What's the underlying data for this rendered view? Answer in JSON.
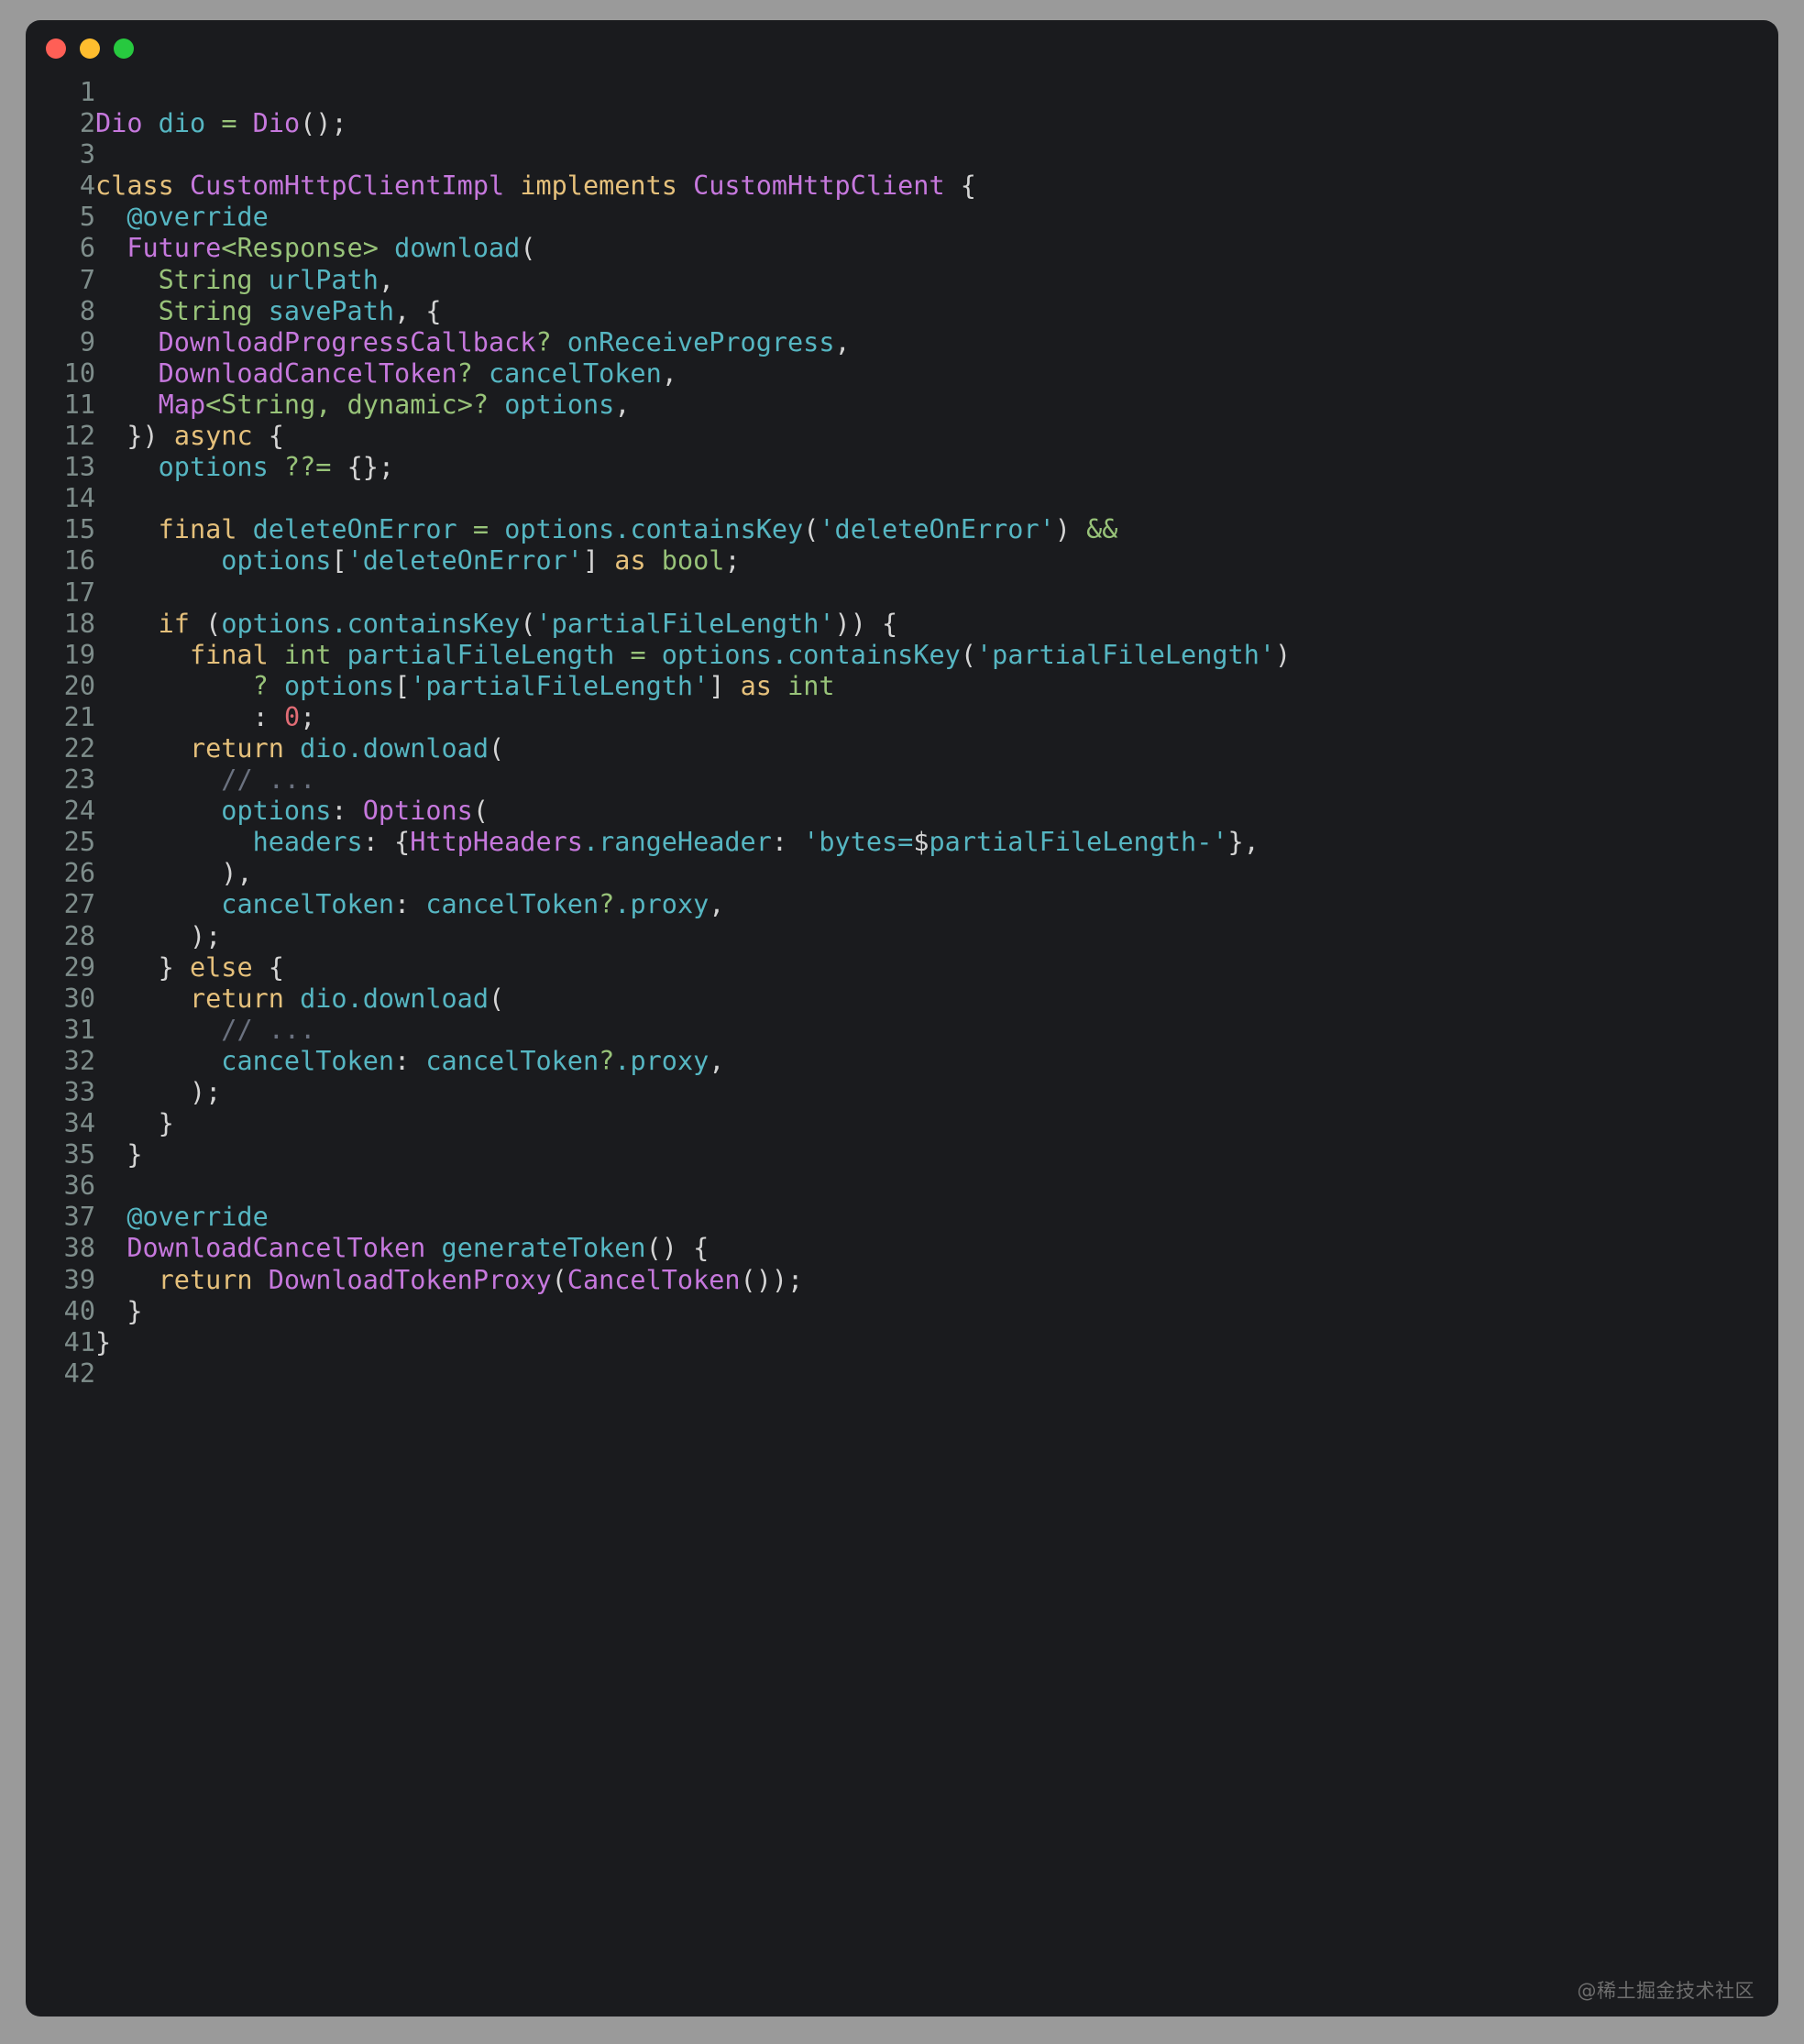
{
  "window": {
    "traffic_lights": [
      {
        "name": "close",
        "color": "#ff5f56"
      },
      {
        "name": "minimize",
        "color": "#ffbd2e"
      },
      {
        "name": "maximize",
        "color": "#27c93f"
      }
    ],
    "background": "#1a1b1e",
    "page_background": "#9a9a9a"
  },
  "watermark": "@稀土掘金技术社区",
  "editor": {
    "language": "dart",
    "first_line_number": 1,
    "last_line_number": 42,
    "line_numbers": [
      "1",
      "2",
      "3",
      "4",
      "5",
      "6",
      "7",
      "8",
      "9",
      "10",
      "11",
      "12",
      "13",
      "14",
      "15",
      "16",
      "17",
      "18",
      "19",
      "20",
      "21",
      "22",
      "23",
      "24",
      "25",
      "26",
      "27",
      "28",
      "29",
      "30",
      "31",
      "32",
      "33",
      "34",
      "35",
      "36",
      "37",
      "38",
      "39",
      "40",
      "41",
      "42"
    ],
    "lines_plain": [
      "",
      "Dio dio = Dio();",
      "",
      "class CustomHttpClientImpl implements CustomHttpClient {",
      "  @override",
      "  Future<Response> download(",
      "    String urlPath,",
      "    String savePath, {",
      "    DownloadProgressCallback? onReceiveProgress,",
      "    DownloadCancelToken? cancelToken,",
      "    Map<String, dynamic>? options,",
      "  }) async {",
      "    options ??= {};",
      "",
      "    final deleteOnError = options.containsKey('deleteOnError') &&",
      "        options['deleteOnError'] as bool;",
      "",
      "    if (options.containsKey('partialFileLength')) {",
      "      final int partialFileLength = options.containsKey('partialFileLength')",
      "          ? options['partialFileLength'] as int",
      "          : 0;",
      "      return dio.download(",
      "        // ...",
      "        options: Options(",
      "          headers: {HttpHeaders.rangeHeader: 'bytes=$partialFileLength-'},",
      "        ),",
      "        cancelToken: cancelToken?.proxy,",
      "      );",
      "    } else {",
      "      return dio.download(",
      "        // ...",
      "        cancelToken: cancelToken?.proxy,",
      "      );",
      "    }",
      "  }",
      "",
      "  @override",
      "  DownloadCancelToken generateToken() {",
      "    return DownloadTokenProxy(CancelToken());",
      "  }",
      "}",
      ""
    ],
    "lines": [
      [],
      [
        {
          "t": "Dio",
          "c": "ty"
        },
        {
          "t": " ",
          "c": "pu"
        },
        {
          "t": "dio",
          "c": "id"
        },
        {
          "t": " ",
          "c": "pu"
        },
        {
          "t": "=",
          "c": "op"
        },
        {
          "t": " ",
          "c": "pu"
        },
        {
          "t": "Dio",
          "c": "ty"
        },
        {
          "t": "();",
          "c": "pu"
        }
      ],
      [],
      [
        {
          "t": "class",
          "c": "k"
        },
        {
          "t": " ",
          "c": "pu"
        },
        {
          "t": "CustomHttpClientImpl",
          "c": "ty"
        },
        {
          "t": " ",
          "c": "pu"
        },
        {
          "t": "implements",
          "c": "k"
        },
        {
          "t": " ",
          "c": "pu"
        },
        {
          "t": "CustomHttpClient",
          "c": "ty"
        },
        {
          "t": " {",
          "c": "pu"
        }
      ],
      [
        {
          "t": "  ",
          "c": "pu"
        },
        {
          "t": "@override",
          "c": "id"
        }
      ],
      [
        {
          "t": "  ",
          "c": "pu"
        },
        {
          "t": "Future",
          "c": "ty"
        },
        {
          "t": "<",
          "c": "bi"
        },
        {
          "t": "Response",
          "c": "bi"
        },
        {
          "t": ">",
          "c": "bi"
        },
        {
          "t": " ",
          "c": "pu"
        },
        {
          "t": "download",
          "c": "id"
        },
        {
          "t": "(",
          "c": "pu"
        }
      ],
      [
        {
          "t": "    ",
          "c": "pu"
        },
        {
          "t": "String",
          "c": "bi"
        },
        {
          "t": " ",
          "c": "pu"
        },
        {
          "t": "urlPath",
          "c": "id"
        },
        {
          "t": ",",
          "c": "pu"
        }
      ],
      [
        {
          "t": "    ",
          "c": "pu"
        },
        {
          "t": "String",
          "c": "bi"
        },
        {
          "t": " ",
          "c": "pu"
        },
        {
          "t": "savePath",
          "c": "id"
        },
        {
          "t": ", {",
          "c": "pu"
        }
      ],
      [
        {
          "t": "    ",
          "c": "pu"
        },
        {
          "t": "DownloadProgressCallback",
          "c": "ty"
        },
        {
          "t": "?",
          "c": "op"
        },
        {
          "t": " ",
          "c": "pu"
        },
        {
          "t": "onReceiveProgress",
          "c": "id"
        },
        {
          "t": ",",
          "c": "pu"
        }
      ],
      [
        {
          "t": "    ",
          "c": "pu"
        },
        {
          "t": "DownloadCancelToken",
          "c": "ty"
        },
        {
          "t": "?",
          "c": "op"
        },
        {
          "t": " ",
          "c": "pu"
        },
        {
          "t": "cancelToken",
          "c": "id"
        },
        {
          "t": ",",
          "c": "pu"
        }
      ],
      [
        {
          "t": "    ",
          "c": "pu"
        },
        {
          "t": "Map",
          "c": "ty"
        },
        {
          "t": "<",
          "c": "bi"
        },
        {
          "t": "String",
          "c": "bi"
        },
        {
          "t": ",",
          "c": "bi"
        },
        {
          "t": " ",
          "c": "pu"
        },
        {
          "t": "dynamic",
          "c": "bi"
        },
        {
          "t": ">",
          "c": "bi"
        },
        {
          "t": "?",
          "c": "op"
        },
        {
          "t": " ",
          "c": "pu"
        },
        {
          "t": "options",
          "c": "id"
        },
        {
          "t": ",",
          "c": "pu"
        }
      ],
      [
        {
          "t": "  })",
          "c": "pu"
        },
        {
          "t": " ",
          "c": "pu"
        },
        {
          "t": "async",
          "c": "k"
        },
        {
          "t": " {",
          "c": "pu"
        }
      ],
      [
        {
          "t": "    ",
          "c": "pu"
        },
        {
          "t": "options",
          "c": "id"
        },
        {
          "t": " ",
          "c": "pu"
        },
        {
          "t": "??",
          "c": "op"
        },
        {
          "t": "=",
          "c": "op"
        },
        {
          "t": " ",
          "c": "pu"
        },
        {
          "t": "{};",
          "c": "pu"
        }
      ],
      [],
      [
        {
          "t": "    ",
          "c": "pu"
        },
        {
          "t": "final",
          "c": "k"
        },
        {
          "t": " ",
          "c": "pu"
        },
        {
          "t": "deleteOnError",
          "c": "id"
        },
        {
          "t": " ",
          "c": "pu"
        },
        {
          "t": "=",
          "c": "op"
        },
        {
          "t": " ",
          "c": "pu"
        },
        {
          "t": "options",
          "c": "id"
        },
        {
          "t": ".",
          "c": "id"
        },
        {
          "t": "containsKey",
          "c": "id"
        },
        {
          "t": "(",
          "c": "pu"
        },
        {
          "t": "'deleteOnError'",
          "c": "st"
        },
        {
          "t": ")",
          "c": "pu"
        },
        {
          "t": " ",
          "c": "pu"
        },
        {
          "t": "&&",
          "c": "op"
        }
      ],
      [
        {
          "t": "        ",
          "c": "pu"
        },
        {
          "t": "options",
          "c": "id"
        },
        {
          "t": "[",
          "c": "pu"
        },
        {
          "t": "'deleteOnError'",
          "c": "st"
        },
        {
          "t": "]",
          "c": "pu"
        },
        {
          "t": " ",
          "c": "pu"
        },
        {
          "t": "as",
          "c": "k"
        },
        {
          "t": " ",
          "c": "pu"
        },
        {
          "t": "bool",
          "c": "bi"
        },
        {
          "t": ";",
          "c": "pu"
        }
      ],
      [],
      [
        {
          "t": "    ",
          "c": "pu"
        },
        {
          "t": "if",
          "c": "k"
        },
        {
          "t": " ",
          "c": "pu"
        },
        {
          "t": "(",
          "c": "pu"
        },
        {
          "t": "options",
          "c": "id"
        },
        {
          "t": ".",
          "c": "id"
        },
        {
          "t": "containsKey",
          "c": "id"
        },
        {
          "t": "(",
          "c": "pu"
        },
        {
          "t": "'partialFileLength'",
          "c": "st"
        },
        {
          "t": "))",
          "c": "pu"
        },
        {
          "t": " {",
          "c": "pu"
        }
      ],
      [
        {
          "t": "      ",
          "c": "pu"
        },
        {
          "t": "final",
          "c": "k"
        },
        {
          "t": " ",
          "c": "pu"
        },
        {
          "t": "int",
          "c": "bi"
        },
        {
          "t": " ",
          "c": "pu"
        },
        {
          "t": "partialFileLength",
          "c": "id"
        },
        {
          "t": " ",
          "c": "pu"
        },
        {
          "t": "=",
          "c": "op"
        },
        {
          "t": " ",
          "c": "pu"
        },
        {
          "t": "options",
          "c": "id"
        },
        {
          "t": ".",
          "c": "id"
        },
        {
          "t": "containsKey",
          "c": "id"
        },
        {
          "t": "(",
          "c": "pu"
        },
        {
          "t": "'partialFileLength'",
          "c": "st"
        },
        {
          "t": ")",
          "c": "pu"
        }
      ],
      [
        {
          "t": "          ",
          "c": "pu"
        },
        {
          "t": "?",
          "c": "op"
        },
        {
          "t": " ",
          "c": "pu"
        },
        {
          "t": "options",
          "c": "id"
        },
        {
          "t": "[",
          "c": "pu"
        },
        {
          "t": "'partialFileLength'",
          "c": "st"
        },
        {
          "t": "]",
          "c": "pu"
        },
        {
          "t": " ",
          "c": "pu"
        },
        {
          "t": "as",
          "c": "k"
        },
        {
          "t": " ",
          "c": "pu"
        },
        {
          "t": "int",
          "c": "bi"
        }
      ],
      [
        {
          "t": "          ",
          "c": "pu"
        },
        {
          "t": ":",
          "c": "pu"
        },
        {
          "t": " ",
          "c": "pu"
        },
        {
          "t": "0",
          "c": "nu"
        },
        {
          "t": ";",
          "c": "pu"
        }
      ],
      [
        {
          "t": "      ",
          "c": "pu"
        },
        {
          "t": "return",
          "c": "k"
        },
        {
          "t": " ",
          "c": "pu"
        },
        {
          "t": "dio",
          "c": "id"
        },
        {
          "t": ".",
          "c": "id"
        },
        {
          "t": "download",
          "c": "id"
        },
        {
          "t": "(",
          "c": "pu"
        }
      ],
      [
        {
          "t": "        ",
          "c": "pu"
        },
        {
          "t": "// ...",
          "c": "cm"
        }
      ],
      [
        {
          "t": "        ",
          "c": "pu"
        },
        {
          "t": "options",
          "c": "id"
        },
        {
          "t": ":",
          "c": "pu"
        },
        {
          "t": " ",
          "c": "pu"
        },
        {
          "t": "Options",
          "c": "ty"
        },
        {
          "t": "(",
          "c": "pu"
        }
      ],
      [
        {
          "t": "          ",
          "c": "pu"
        },
        {
          "t": "headers",
          "c": "id"
        },
        {
          "t": ":",
          "c": "pu"
        },
        {
          "t": " {",
          "c": "pu"
        },
        {
          "t": "HttpHeaders",
          "c": "ty"
        },
        {
          "t": ".",
          "c": "id"
        },
        {
          "t": "rangeHeader",
          "c": "id"
        },
        {
          "t": ":",
          "c": "pu"
        },
        {
          "t": " ",
          "c": "pu"
        },
        {
          "t": "'bytes=",
          "c": "st"
        },
        {
          "t": "$",
          "c": "iv"
        },
        {
          "t": "partialFileLength-'",
          "c": "st"
        },
        {
          "t": "},",
          "c": "pu"
        }
      ],
      [
        {
          "t": "        ),",
          "c": "pu"
        }
      ],
      [
        {
          "t": "        ",
          "c": "pu"
        },
        {
          "t": "cancelToken",
          "c": "id"
        },
        {
          "t": ":",
          "c": "pu"
        },
        {
          "t": " ",
          "c": "pu"
        },
        {
          "t": "cancelToken",
          "c": "id"
        },
        {
          "t": "?",
          "c": "op"
        },
        {
          "t": ".",
          "c": "id"
        },
        {
          "t": "proxy",
          "c": "id"
        },
        {
          "t": ",",
          "c": "pu"
        }
      ],
      [
        {
          "t": "      );",
          "c": "pu"
        }
      ],
      [
        {
          "t": "    }",
          "c": "pu"
        },
        {
          "t": " ",
          "c": "pu"
        },
        {
          "t": "else",
          "c": "k"
        },
        {
          "t": " {",
          "c": "pu"
        }
      ],
      [
        {
          "t": "      ",
          "c": "pu"
        },
        {
          "t": "return",
          "c": "k"
        },
        {
          "t": " ",
          "c": "pu"
        },
        {
          "t": "dio",
          "c": "id"
        },
        {
          "t": ".",
          "c": "id"
        },
        {
          "t": "download",
          "c": "id"
        },
        {
          "t": "(",
          "c": "pu"
        }
      ],
      [
        {
          "t": "        ",
          "c": "pu"
        },
        {
          "t": "// ...",
          "c": "cm"
        }
      ],
      [
        {
          "t": "        ",
          "c": "pu"
        },
        {
          "t": "cancelToken",
          "c": "id"
        },
        {
          "t": ":",
          "c": "pu"
        },
        {
          "t": " ",
          "c": "pu"
        },
        {
          "t": "cancelToken",
          "c": "id"
        },
        {
          "t": "?",
          "c": "op"
        },
        {
          "t": ".",
          "c": "id"
        },
        {
          "t": "proxy",
          "c": "id"
        },
        {
          "t": ",",
          "c": "pu"
        }
      ],
      [
        {
          "t": "      );",
          "c": "pu"
        }
      ],
      [
        {
          "t": "    }",
          "c": "pu"
        }
      ],
      [
        {
          "t": "  }",
          "c": "pu"
        }
      ],
      [],
      [
        {
          "t": "  ",
          "c": "pu"
        },
        {
          "t": "@override",
          "c": "id"
        }
      ],
      [
        {
          "t": "  ",
          "c": "pu"
        },
        {
          "t": "DownloadCancelToken",
          "c": "ty"
        },
        {
          "t": " ",
          "c": "pu"
        },
        {
          "t": "generateToken",
          "c": "id"
        },
        {
          "t": "()",
          "c": "pu"
        },
        {
          "t": " {",
          "c": "pu"
        }
      ],
      [
        {
          "t": "    ",
          "c": "pu"
        },
        {
          "t": "return",
          "c": "k"
        },
        {
          "t": " ",
          "c": "pu"
        },
        {
          "t": "DownloadTokenProxy",
          "c": "ty"
        },
        {
          "t": "(",
          "c": "pu"
        },
        {
          "t": "CancelToken",
          "c": "ty"
        },
        {
          "t": "());",
          "c": "pu"
        }
      ],
      [
        {
          "t": "  }",
          "c": "pu"
        }
      ],
      [
        {
          "t": "}",
          "c": "pu"
        }
      ],
      []
    ]
  }
}
